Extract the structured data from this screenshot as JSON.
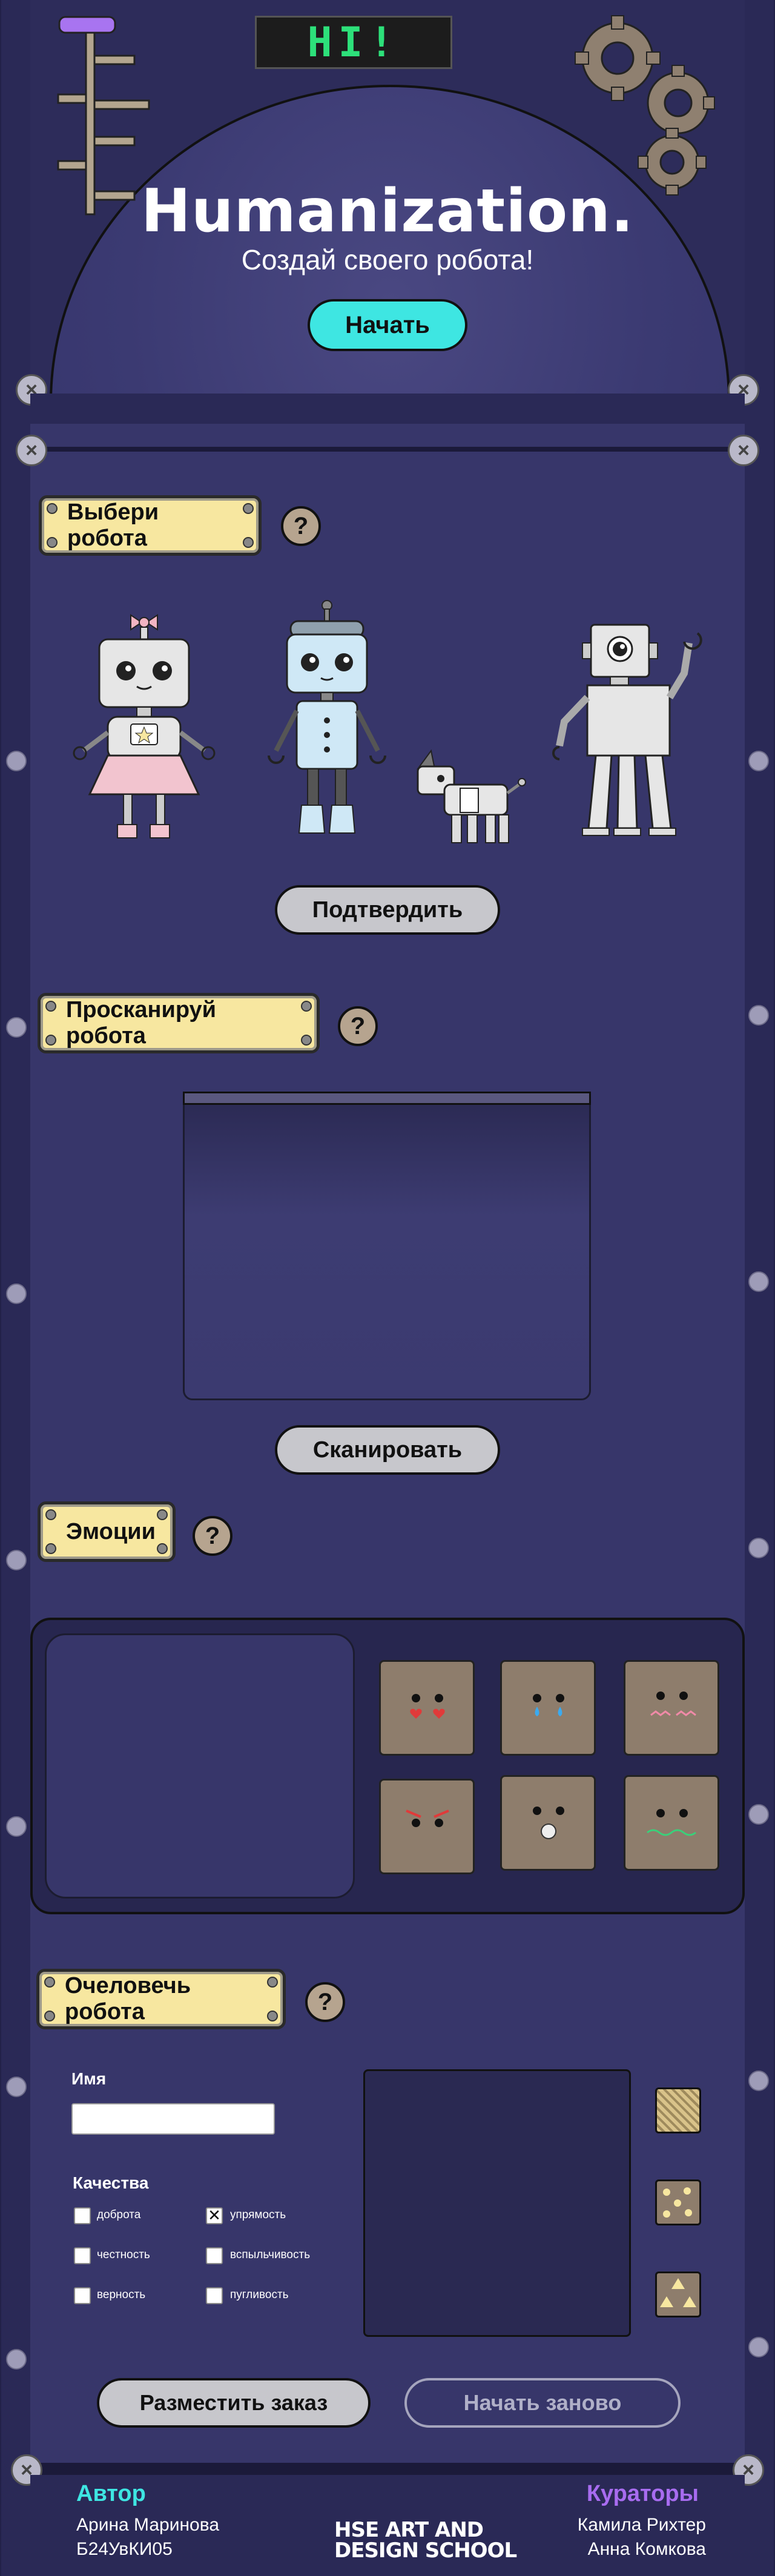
{
  "header": {
    "led_text": "HI!",
    "title": "Humanization.",
    "subtitle": "Создай своего робота!",
    "start_label": "Начать"
  },
  "sections": {
    "choose": {
      "label": "Выбери робота",
      "help": "?",
      "confirm_label": "Подтвердить"
    },
    "scan": {
      "label": "Просканируй робота",
      "help": "?",
      "scan_label": "Сканировать"
    },
    "emotions": {
      "label": "Эмоции",
      "help": "?"
    },
    "humanize": {
      "label": "Очеловечь робота",
      "help": "?",
      "name_label": "Имя",
      "name_value": "",
      "qualities_label": "Качества",
      "qualities": [
        {
          "label": "доброта",
          "checked": false
        },
        {
          "label": "упрямость",
          "checked": true
        },
        {
          "label": "честность",
          "checked": false
        },
        {
          "label": "вспыльчивость",
          "checked": false
        },
        {
          "label": "верность",
          "checked": false
        },
        {
          "label": "пугливость",
          "checked": false
        }
      ],
      "order_label": "Разместить заказ",
      "restart_label": "Начать заново"
    }
  },
  "footer": {
    "author_title": "Автор",
    "author_name": "Арина Маринова",
    "author_group": "Б24УвКИ05",
    "logo_line1": "HSE ART AND",
    "logo_line2": "DESIGN SCHOOL",
    "curators_title": "Кураторы",
    "curator_1": "Камила Рихтер",
    "curator_2": "Анна Комкова"
  },
  "colors": {
    "accent_cyan": "#3ee6e2",
    "plaque_yellow": "#f7e7a0",
    "author_cyan": "#3ee6e2",
    "curators_purple": "#a86cf0",
    "led_green": "#2de07a"
  },
  "icons": [
    "close-x-screw-icon",
    "gear-icon",
    "question-icon",
    "checkbox-x-icon"
  ]
}
